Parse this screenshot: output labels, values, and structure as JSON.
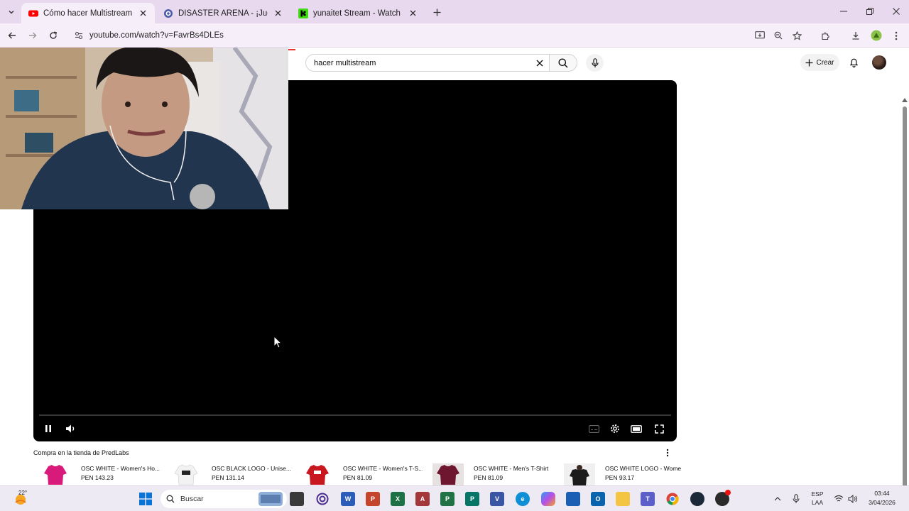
{
  "browser": {
    "tabs": [
      {
        "title": "Cómo hacer Multistream gratis",
        "active": true,
        "favicon": "youtube-icon"
      },
      {
        "title": "DISASTER ARENA - ¡Juega Grati",
        "active": false,
        "favicon": "globe-icon"
      },
      {
        "title": "yunaitet Stream - Watch Live o",
        "active": false,
        "favicon": "kick-icon"
      }
    ],
    "url": "youtube.com/watch?v=FavrBs4DLEs"
  },
  "youtube": {
    "search_query": "hacer multistream",
    "create_label": "Crear",
    "shop": {
      "title": "Compra en la tienda de PredLabs",
      "products": [
        {
          "name": "OSC WHITE - Women's Ho...",
          "price": "PEN 143.23",
          "color": "#d81b7a"
        },
        {
          "name": "OSC BLACK LOGO - Unise...",
          "price": "PEN 131.14",
          "color": "#f2f2f2"
        },
        {
          "name": "OSC WHITE - Women's T-S...",
          "price": "PEN 81.09",
          "color": "#c8171e"
        },
        {
          "name": "OSC WHITE - Men's T-Shirt",
          "price": "PEN 81.09",
          "color": "#6e1530"
        },
        {
          "name": "OSC WHITE LOGO - Wome",
          "price": "PEN 93.17",
          "color": "#1c1c1c"
        }
      ]
    },
    "player": {
      "progress_fraction": 0.0,
      "state": "playing"
    }
  },
  "taskbar": {
    "search_placeholder": "Buscar",
    "weather_temp": "22°",
    "language": "ESP",
    "layout": "LAA",
    "time": "03:44",
    "date": "3/04/2026"
  },
  "colors": {
    "tabbar": "#e8d9ef",
    "toolbar": "#f6eef9",
    "youtube_red": "#ff0000"
  }
}
